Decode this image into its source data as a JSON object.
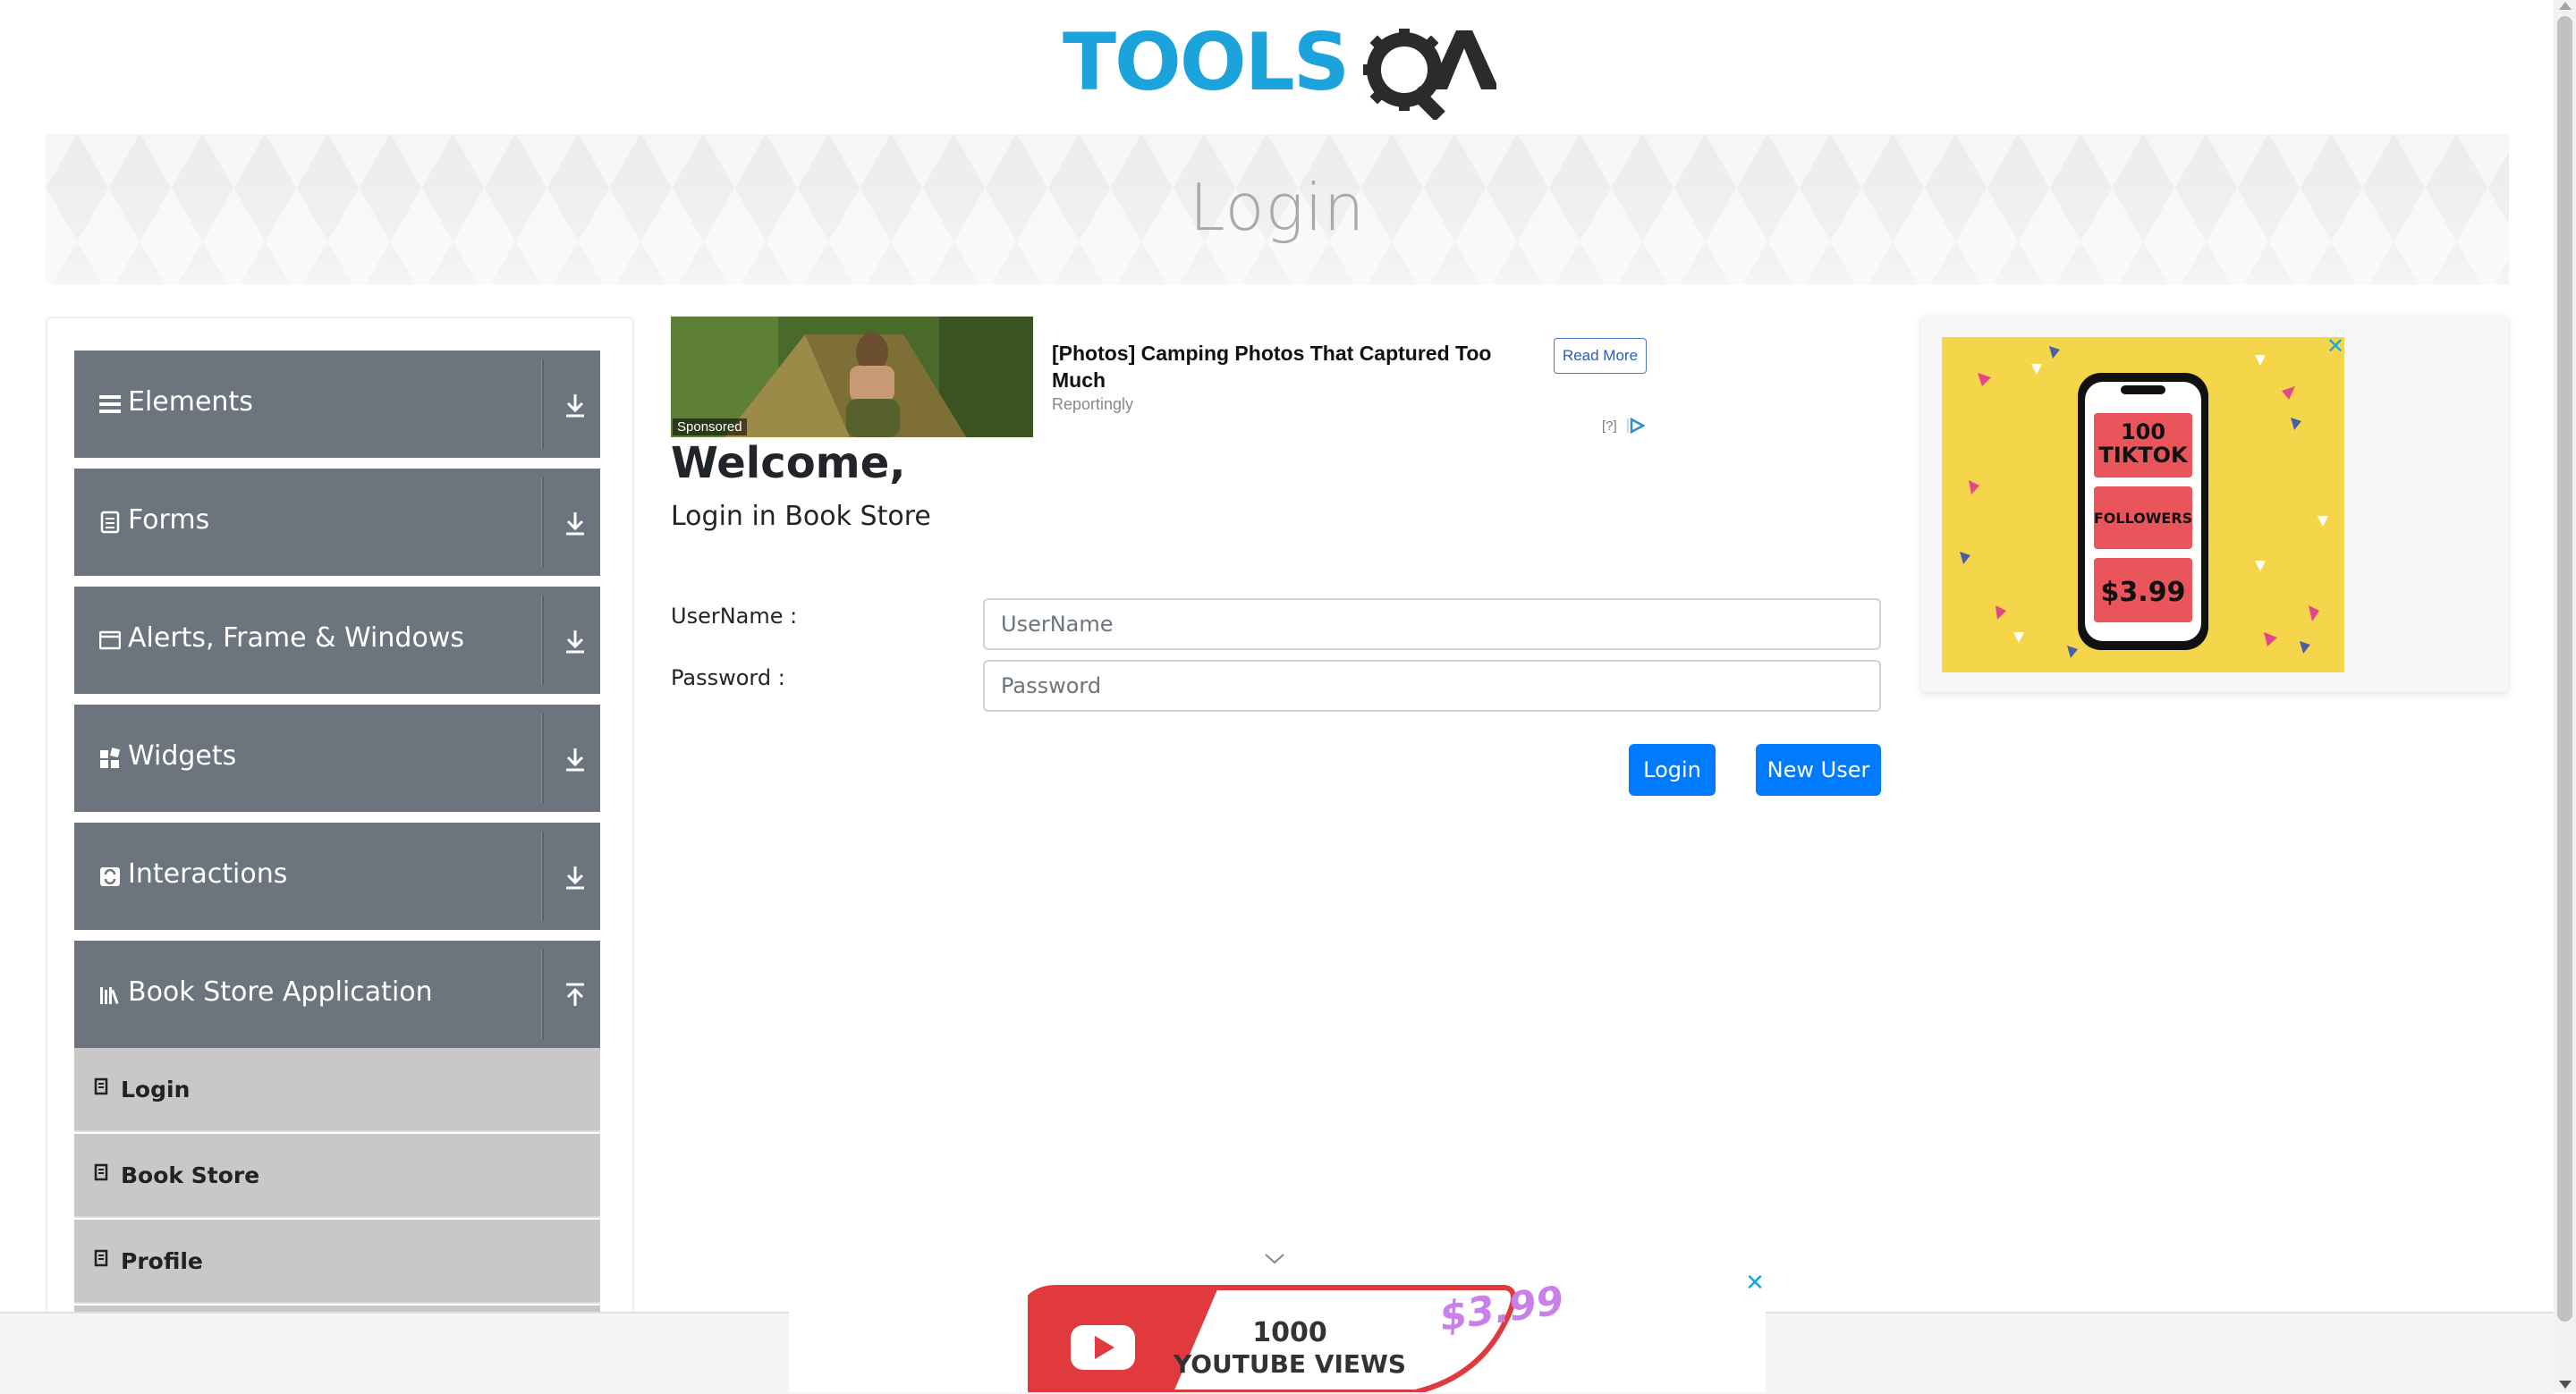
{
  "header": {
    "logo_text": "TOOLSQA"
  },
  "banner": {
    "title": "Login"
  },
  "sidebar": {
    "groups": [
      {
        "label": "Elements",
        "icon": "hamburger-icon"
      },
      {
        "label": "Forms",
        "icon": "document-icon"
      },
      {
        "label": "Alerts, Frame & Windows",
        "icon": "window-icon"
      },
      {
        "label": "Widgets",
        "icon": "widgets-icon"
      },
      {
        "label": "Interactions",
        "icon": "interactions-icon"
      },
      {
        "label": "Book Store Application",
        "icon": "books-icon",
        "expanded": true
      }
    ],
    "book_store_items": [
      {
        "label": "Login"
      },
      {
        "label": "Book Store"
      },
      {
        "label": "Profile"
      }
    ]
  },
  "top_ad": {
    "badge": "Sponsored",
    "title": "[Photos] Camping Photos That Captured Too Much",
    "source": "Reportingly",
    "button": "Read More",
    "choice": "[?]"
  },
  "main": {
    "heading": "Welcome,",
    "subheading": "Login in Book Store",
    "username_label": "UserName :",
    "username_placeholder": "UserName",
    "password_label": "Password :",
    "password_placeholder": "Password",
    "login_button": "Login",
    "new_user_button": "New User"
  },
  "right_ad": {
    "line1": "100",
    "line2": "TIKTOK",
    "line3": "FOLLOWERS",
    "price": "$3.99",
    "close": "✕"
  },
  "bottom_ad": {
    "line1": "1000",
    "line2": "YOUTUBE VIEWS",
    "price": "$3.99",
    "close": "✕"
  },
  "colors": {
    "brand_blue": "#1da3db",
    "primary": "#007bff",
    "sidebar_group": "#6c757d",
    "sidebar_item": "#c8c8c8"
  }
}
